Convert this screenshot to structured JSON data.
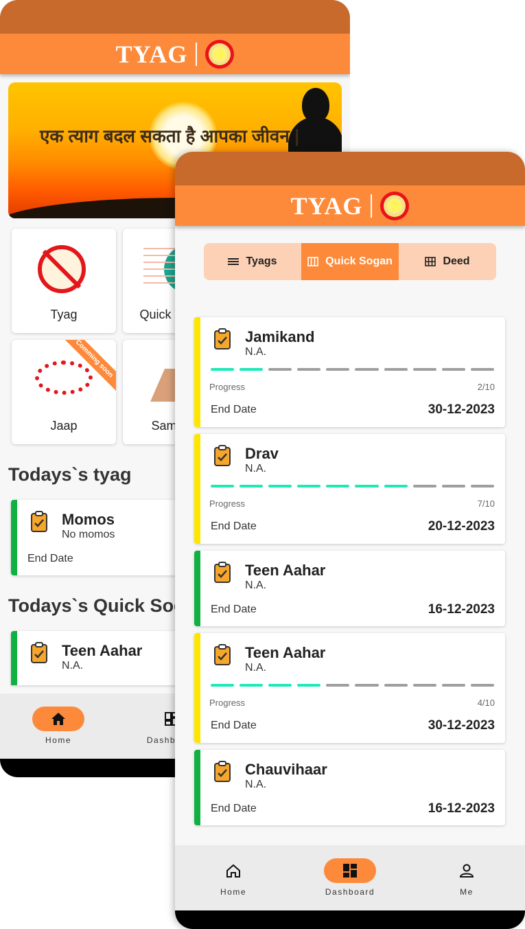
{
  "brand": {
    "name": "TYAG"
  },
  "back": {
    "banner_text": "एक त्याग बदल सकता है आपका जीवन |",
    "tiles": [
      {
        "label": "Tyag"
      },
      {
        "label": "Quick Sogan"
      },
      {
        "label": "Jaap",
        "ribbon": "Comming soon"
      },
      {
        "label": "Samayik"
      }
    ],
    "section_tyag": "Todays`s tyag",
    "tyag_card": {
      "title": "Momos",
      "subtitle": "No momos",
      "end_label": "End Date"
    },
    "section_quick": "Todays`s Quick Sogan",
    "quick_card": {
      "title": "Teen Aahar",
      "subtitle": "N.A."
    },
    "nav": {
      "home": "Home",
      "dashboard": "Dashboard"
    }
  },
  "front": {
    "tabs": [
      {
        "label": "Tyags",
        "icon": "list-icon",
        "active": false
      },
      {
        "label": "Quick Sogan",
        "icon": "columns-icon",
        "active": true
      },
      {
        "label": "Deed",
        "icon": "grid-icon",
        "active": false
      }
    ],
    "cards": [
      {
        "title": "Jamikand",
        "subtitle": "N.A.",
        "progress_label": "Progress",
        "progress_count": "2/10",
        "progress_done": 2,
        "progress_total": 10,
        "end_label": "End Date",
        "end_date": "30-12-2023",
        "accent": "#ffe600"
      },
      {
        "title": "Drav",
        "subtitle": "N.A.",
        "progress_label": "Progress",
        "progress_count": "7/10",
        "progress_done": 7,
        "progress_total": 10,
        "end_label": "End Date",
        "end_date": "20-12-2023",
        "accent": "#ffe600"
      },
      {
        "title": "Teen Aahar",
        "subtitle": "N.A.",
        "end_label": "End Date",
        "end_date": "16-12-2023",
        "accent": "#10b042"
      },
      {
        "title": "Teen Aahar",
        "subtitle": "N.A.",
        "progress_label": "Progress",
        "progress_count": "4/10",
        "progress_done": 4,
        "progress_total": 10,
        "end_label": "End Date",
        "end_date": "30-12-2023",
        "accent": "#ffe600"
      },
      {
        "title": "Chauvihaar",
        "subtitle": "N.A.",
        "end_label": "End Date",
        "end_date": "16-12-2023",
        "accent": "#10b042"
      }
    ],
    "nav": {
      "home": "Home",
      "dashboard": "Dashboard",
      "me": "Me"
    }
  },
  "colors": {
    "primary": "#fd8a3a",
    "status": "#c96a2d",
    "progress": "#1de9b6",
    "accent_yellow": "#ffe600",
    "accent_green": "#10b042"
  }
}
